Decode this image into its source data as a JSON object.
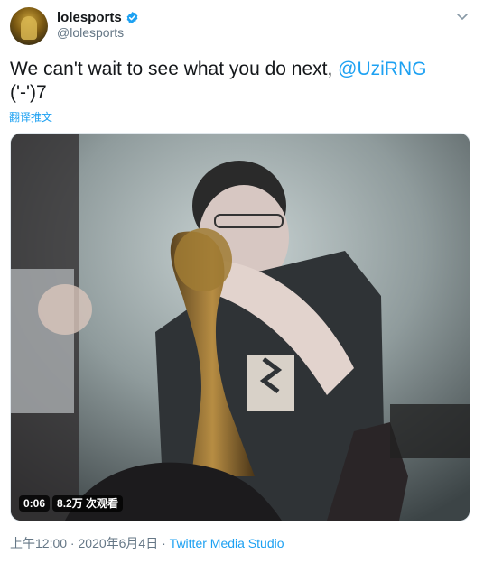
{
  "user": {
    "display_name": "lolesports",
    "handle": "@lolesports",
    "verified": true
  },
  "menu_icon": "chevron-down-icon",
  "tweet": {
    "text_part1": "We can't wait to see what you do next, ",
    "mention": "@UziRNG",
    "text_part2": "('-')7",
    "translate_label": "翻译推文"
  },
  "video": {
    "duration": "0:06",
    "views": "8.2万 次观看"
  },
  "meta": {
    "time": "上午12:00",
    "separator1": " · ",
    "date": "2020年6月4日",
    "separator2": " · ",
    "source": "Twitter Media Studio"
  },
  "colors": {
    "accent": "#1da1f2",
    "text": "#14171a",
    "muted": "#657786"
  }
}
